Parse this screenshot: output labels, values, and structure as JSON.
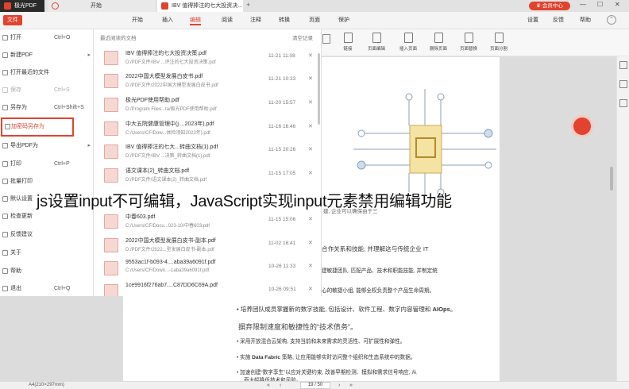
{
  "titlebar": {
    "tabs": [
      {
        "label": "极光PDF",
        "color": "#e2432f"
      },
      {
        "label": "开始",
        "color": "#e2432f"
      },
      {
        "label": "IBV 值得捧注的七大投资决...",
        "color": "#e2432f"
      }
    ],
    "vip": "会员中心",
    "win_controls": [
      "—",
      "☐",
      "✕"
    ]
  },
  "menubar": {
    "file_btn": "文件",
    "items": [
      "开始",
      "插入",
      "编辑",
      "阅读",
      "注释",
      "转换",
      "页面",
      "保护"
    ],
    "active": "编辑",
    "right": [
      "设置",
      "反馈",
      "帮助"
    ]
  },
  "toolbar": {
    "items": [
      "链接",
      "页面编辑",
      "插入页面",
      "删除页面",
      "页面替换",
      "页面分割"
    ]
  },
  "side_menu": [
    {
      "label": "打开",
      "key": "Ctrl+O",
      "icon": "folder-icon"
    },
    {
      "label": "新建PDF",
      "key": "",
      "arrow": "▸",
      "icon": "new-file-icon"
    },
    {
      "label": "打开最近的文件",
      "key": "",
      "icon": "recent-icon"
    },
    {
      "label": "保存",
      "key": "Ctrl+S",
      "icon": "save-icon",
      "disabled": true
    },
    {
      "label": "另存为",
      "key": "Ctrl+Shift+S",
      "icon": "save-as-icon"
    },
    {
      "label": "加密码另存为",
      "key": "",
      "icon": "lock-icon",
      "highlight": true
    },
    {
      "label": "导出PDF为",
      "key": "",
      "arrow": "▸",
      "icon": "export-icon"
    },
    {
      "label": "打印",
      "key": "Ctrl+P",
      "icon": "print-icon"
    },
    {
      "label": "批量打印",
      "key": "",
      "icon": "batch-print-icon"
    },
    {
      "label": "默认设置",
      "key": "",
      "icon": "settings-icon"
    },
    {
      "label": "检查更新",
      "key": "",
      "icon": "update-icon"
    },
    {
      "label": "反馈建议",
      "key": "",
      "icon": "feedback-icon"
    },
    {
      "label": "关于",
      "key": "",
      "icon": "info-icon"
    },
    {
      "label": "帮助",
      "key": "",
      "icon": "help-icon"
    },
    {
      "label": "退出",
      "key": "Ctrl+Q",
      "icon": "exit-icon"
    }
  ],
  "recent": {
    "header": "最近阅读的文档",
    "clear": "清空记录",
    "files": [
      {
        "name": "IBV 值得捧注的七大投资决策.pdf",
        "path": "D:/PDF文件/IBV ...评注的七大投资决策.pdf",
        "date": "11-21 11:08"
      },
      {
        "name": "2022中国大模型发展白皮书.pdf",
        "path": "D:/PDF文件/2022中国大模型发展白皮书.pdf",
        "date": "11-21 10:33"
      },
      {
        "name": "极光PDF使用帮助.pdf",
        "path": "D:/Program Files...ta/极光PDF使用帮助.pdf",
        "date": "11-20 15:57"
      },
      {
        "name": "中大五院健康管理中(j....2023年).pdf",
        "path": "C:/Users/CF/Dow...体检须知2023年).pdf",
        "date": "11-16 16:46"
      },
      {
        "name": "IBV 值得捧注的七大...转曲文档(1).pdf",
        "path": "D:/PDF文件/IBV ...决策_转曲文档(1).pdf",
        "date": "11-15 20:26"
      },
      {
        "name": "语文课本(2)_转曲文档.pdf",
        "path": "D:/PDF文件/语文课本(2)_转曲文档.pdf",
        "date": "11-15 17:05"
      },
      {
        "name": "",
        "path": "",
        "date": ""
      },
      {
        "name": "中春603.pdf",
        "path": "C:/Users/CF/Docu...023-10/中春603.pdf",
        "date": "11-15 15:06"
      },
      {
        "name": "2022中国大模型发展白皮书-副本.pdf",
        "path": "D:/PDF文件/2022...型发展白皮书-副本.pdf",
        "date": "11-02 16:41"
      },
      {
        "name": "9553ac1f-b093-4....aba39a6091f.pdf",
        "path": "C:/Users/CF/Down...-1aba39a6091f.pdf",
        "date": "10-26 11:33"
      },
      {
        "name": "1ce9916f276ab7....C87DD6C69A.pdf",
        "path": "",
        "date": "10-26 09:51"
      }
    ]
  },
  "document": {
    "lines_right": [
      "合作关系和技能; 并理解这与传统企业 IT",
      "建敏捷团队, 匹配产品、技术和职能技能, 并制定统",
      "心的敏捷小组, 能够全权负责整个产品生命周期。"
    ],
    "partial_line": "建, 企业可以确保由于三",
    "bullet1_pre": "培养团队成员掌握新的数字技能, 包括设计、软件工程、数字内容管理和 ",
    "bullet1_bold": "AIOps",
    "bullet1_post": "。",
    "heading": "摒弃限制速度和敏捷性的“技术债务”。",
    "bullet2": "采用开放混合云架构, 支持当前和未来需求的灵活性、可扩展性和弹性。",
    "bullet3_pre": "实施 ",
    "bullet3_bold": "Data Fabric",
    "bullet3_post": " 策略, 让应用能够实时访问整个组织和生态系统中的数据。",
    "bullet4": "加速创建“数字孪生”以应对关键约束, 改善早期检测、模拟和需求信号响应, 从",
    "bullet4b": "而大幅降低技术和风险。"
  },
  "status": {
    "page_size": "A4(210×297mm)",
    "page": "19 / 50"
  },
  "overlay": {
    "text": "js设置input不可编辑，JavaScript实现input元素禁用编辑功能"
  },
  "colors": {
    "accent": "#e2432f",
    "menu_highlight_border": "#e2432f"
  }
}
